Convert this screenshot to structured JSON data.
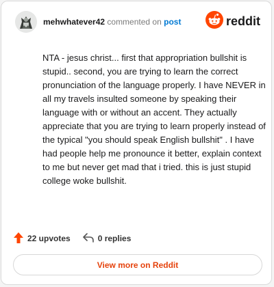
{
  "header": {
    "avatar_icon": "user-avatar-icon",
    "username": "mehwhatever42",
    "action_text": "commented on",
    "post_link": "post",
    "brand_icon": "reddit-snoo-icon",
    "brand_name": "reddit"
  },
  "comment": {
    "text": "NTA - jesus christ... first that appropriation bullshit is stupid.. second, you are trying to learn the correct pronunciation of the language properly. I have NEVER in all my travels insulted someone by speaking their language with or without an accent. They actually appreciate that you are trying to learn properly instead of the typical \"you should speak English bullshit\" . I have had people help me pronounce it better, explain context to me but never get mad that i tried. this is just stupid college woke bullshit."
  },
  "stats": {
    "upvotes_icon": "upvote-arrow-icon",
    "upvotes_label": "22 upvotes",
    "replies_icon": "reply-arrow-icon",
    "replies_label": "0 replies"
  },
  "actions": {
    "view_more_label": "View more on Reddit"
  },
  "colors": {
    "brand_orange": "#ff4500",
    "link_blue": "#0079d3",
    "button_text": "#e5420c"
  }
}
